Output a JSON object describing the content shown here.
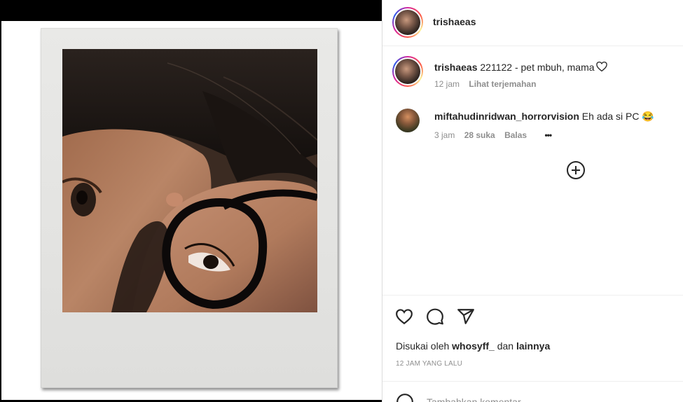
{
  "post": {
    "author": "trishaeas"
  },
  "caption": {
    "username": "trishaeas",
    "text": "221122 - pet mbuh, mama",
    "time": "12 jam",
    "translate": "Lihat terjemahan"
  },
  "comments": [
    {
      "username": "miftahudinridwan_horrorvision",
      "text": "Eh ada si PC 😂",
      "time": "3 jam",
      "likes": "28 suka",
      "reply": "Balas",
      "more": "•••"
    }
  ],
  "likes": {
    "prefix": "Disukai oleh",
    "user": "whosyff_",
    "conj": "dan",
    "others": "lainnya"
  },
  "timestamp": "12 JAM YANG LALU",
  "add_comment": {
    "placeholder": "Tambahkan komentar..."
  },
  "icons": {
    "caption_heart": "heart-outline-icon",
    "like": "heart-outline-icon",
    "comment": "comment-bubble-icon",
    "share": "paper-plane-icon",
    "load_more": "plus-circle-icon",
    "emoji": "emoji-smile-icon"
  }
}
